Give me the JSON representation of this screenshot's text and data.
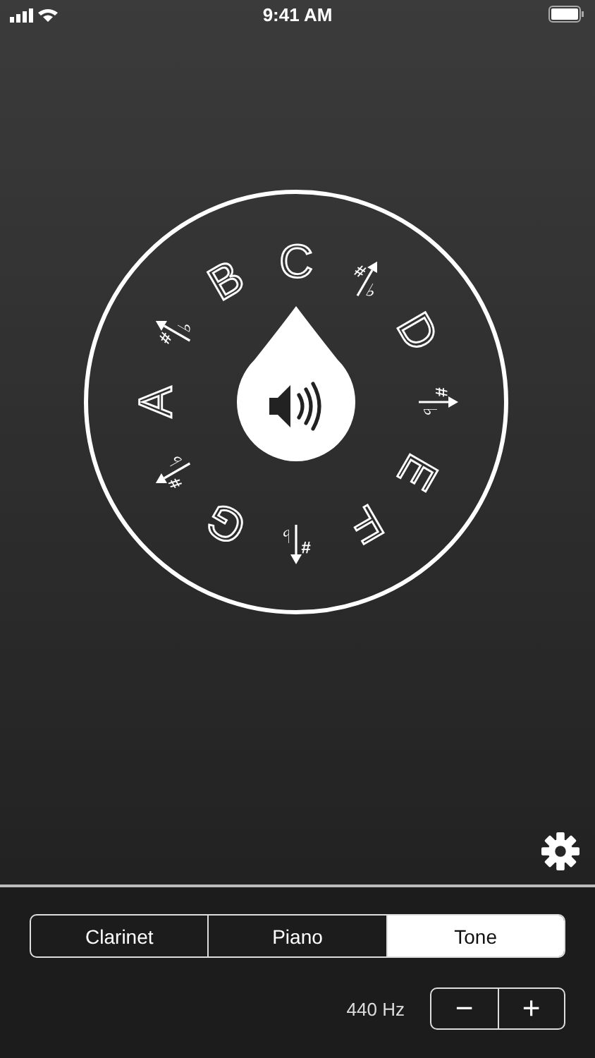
{
  "status_bar": {
    "time": "9:41 AM"
  },
  "dial": {
    "notes": [
      {
        "kind": "letter",
        "text": "C"
      },
      {
        "kind": "accidental",
        "sharp": "#",
        "flat": "♭"
      },
      {
        "kind": "letter",
        "text": "D"
      },
      {
        "kind": "accidental",
        "sharp": "#",
        "flat": "♭"
      },
      {
        "kind": "letter",
        "text": "E"
      },
      {
        "kind": "letter",
        "text": "F"
      },
      {
        "kind": "accidental",
        "sharp": "#",
        "flat": "♭"
      },
      {
        "kind": "letter",
        "text": "G"
      },
      {
        "kind": "accidental",
        "sharp": "#",
        "flat": "♭"
      },
      {
        "kind": "letter",
        "text": "A"
      },
      {
        "kind": "accidental",
        "sharp": "#",
        "flat": "♭"
      },
      {
        "kind": "letter",
        "text": "B"
      }
    ]
  },
  "instruments": [
    {
      "label": "Clarinet",
      "selected": false
    },
    {
      "label": "Piano",
      "selected": false
    },
    {
      "label": "Tone",
      "selected": true
    }
  ],
  "frequency": {
    "reading": "440 Hz",
    "decrement": "−",
    "increment": "+"
  }
}
